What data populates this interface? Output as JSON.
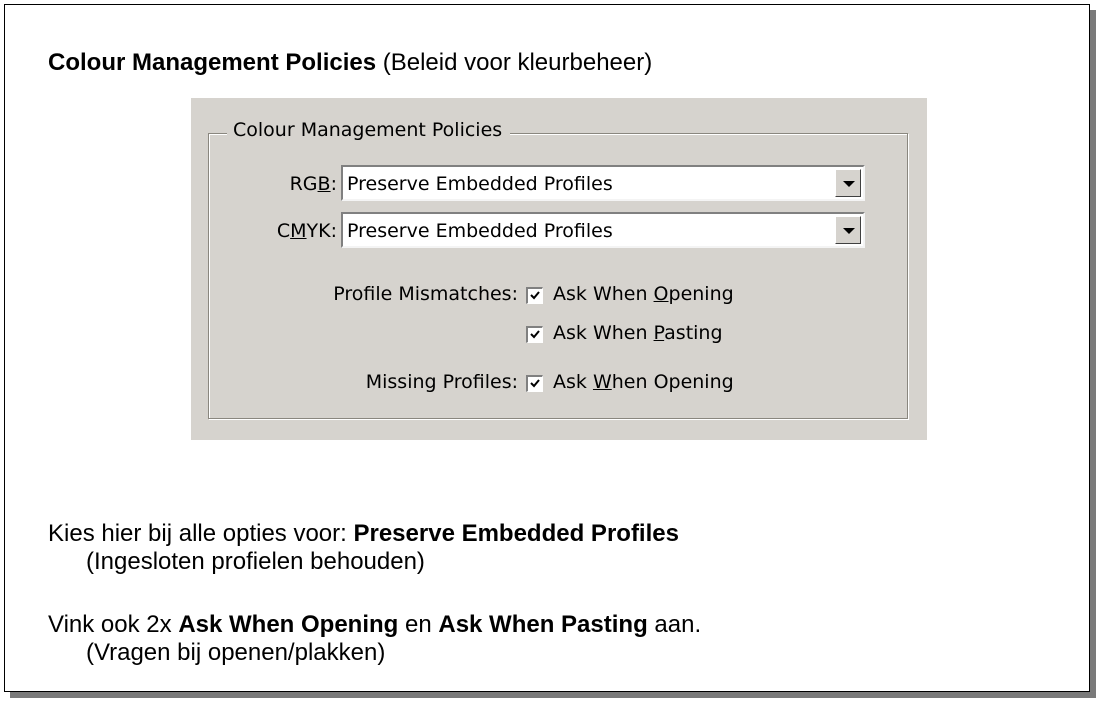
{
  "heading": {
    "bold": "Colour Management Policies",
    "normal": " (Beleid voor kleurbeheer)"
  },
  "dialog": {
    "group_title": "Colour Management Policies",
    "rgb": {
      "label_pre": "RG",
      "label_ul": "B",
      "label_post": ":",
      "value": "Preserve Embedded Profiles"
    },
    "cmyk": {
      "label_pre": "C",
      "label_ul": "M",
      "label_post": "YK:",
      "value": "Preserve Embedded Profiles"
    },
    "profile_mismatches_label": "Profile Mismatches:",
    "ask_opening": {
      "pre": "Ask When ",
      "ul": "O",
      "post": "pening",
      "checked": true
    },
    "ask_pasting": {
      "pre": "Ask When ",
      "ul": "P",
      "post": "asting",
      "checked": true
    },
    "missing_profiles_label": "Missing Profiles:",
    "ask_missing": {
      "pre": "Ask ",
      "ul": "W",
      "post": "hen Opening",
      "checked": true
    }
  },
  "instructions": {
    "line1_pre": "Kies hier bij alle opties voor: ",
    "line1_bold": "Preserve Embedded Profiles",
    "line1_sub": "(Ingesloten profielen behouden)",
    "line2_pre": "Vink ook 2x ",
    "line2_bold1": "Ask When Opening",
    "line2_mid": " en ",
    "line2_bold2": "Ask When Pasting",
    "line2_post": " aan.",
    "line2_sub": "(Vragen bij openen/plakken)"
  }
}
